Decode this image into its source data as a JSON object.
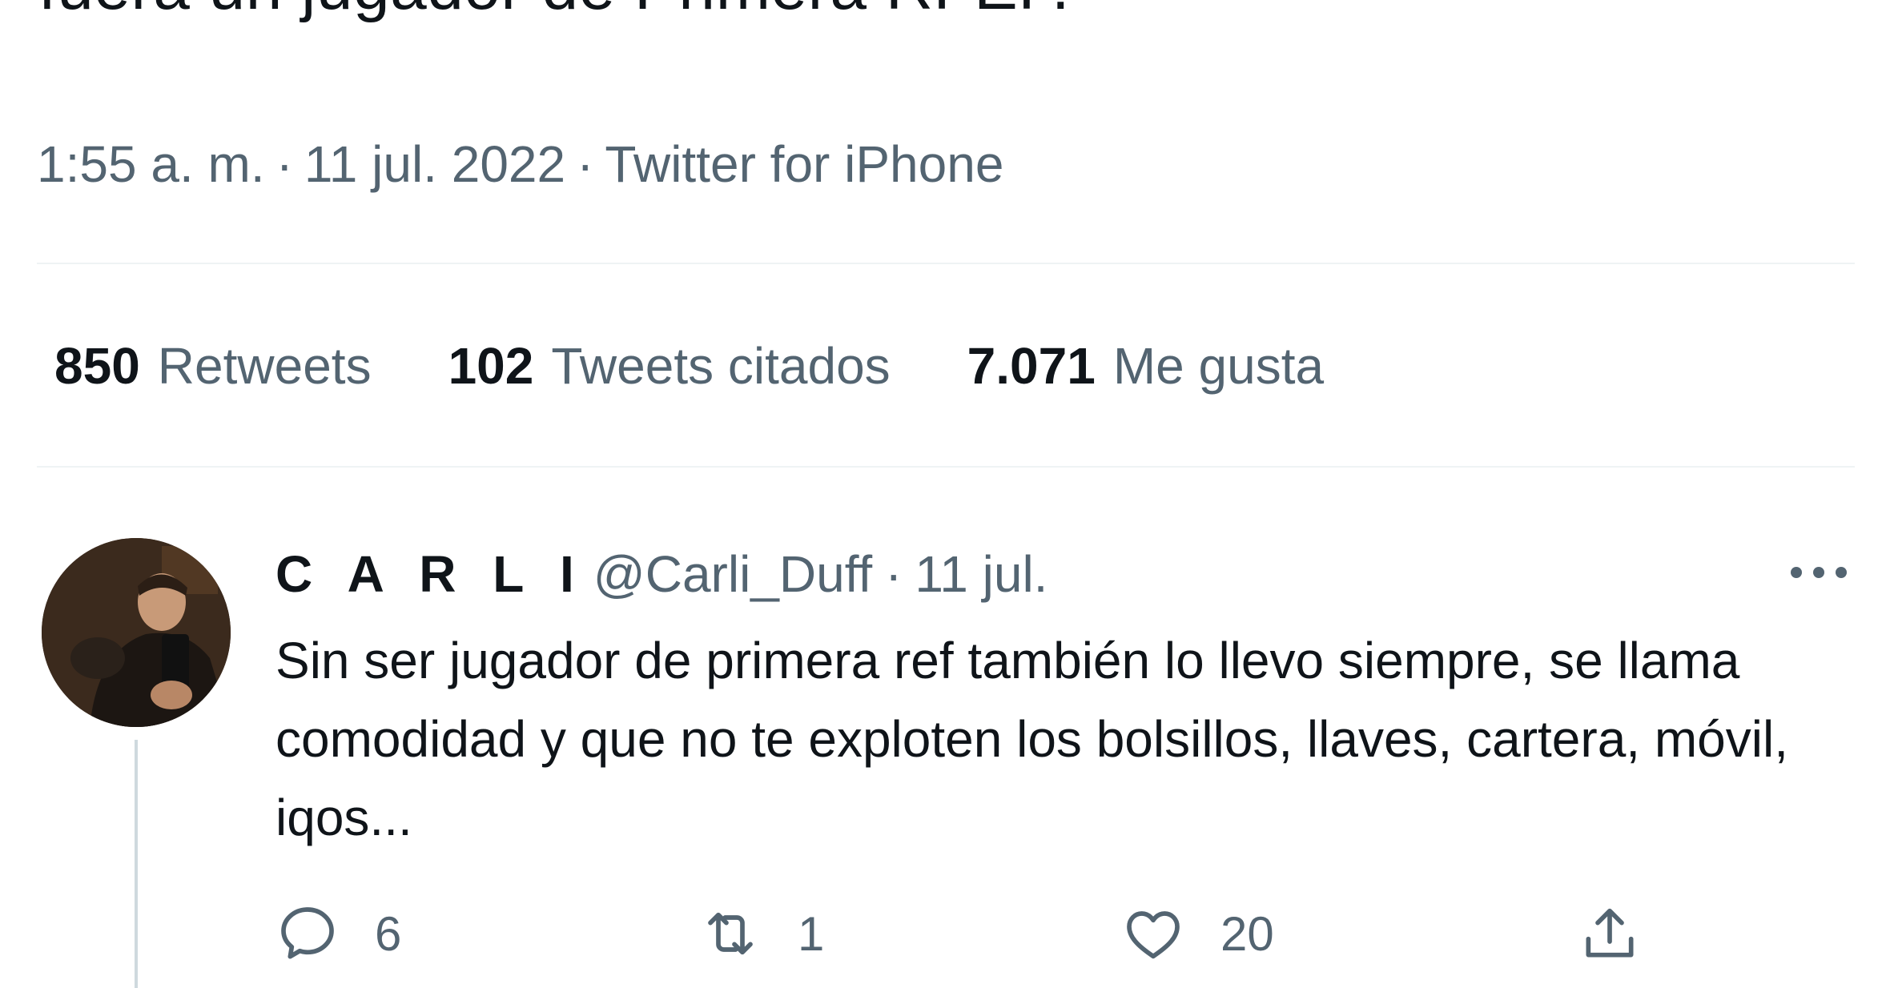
{
  "tweet": {
    "text_fragment": "fuera un jugador de Primera RFEF.",
    "time": "1:55 a. m.",
    "date": "11 jul. 2022",
    "source": "Twitter for iPhone",
    "separator": "·"
  },
  "stats": [
    {
      "count": "850",
      "label": "Retweets"
    },
    {
      "count": "102",
      "label": "Tweets citados"
    },
    {
      "count": "7.071",
      "label": "Me gusta"
    }
  ],
  "reply": {
    "name": "C A R L I",
    "handle": "@Carli_Duff",
    "separator": "·",
    "time": "11 jul.",
    "text": "Sin ser jugador de primera ref también lo llevo siempre, se llama comodidad y que no te exploten los bolsillos, llaves, cartera, móvil, iqos...",
    "actions": {
      "reply_count": "6",
      "retweet_count": "1",
      "like_count": "20"
    }
  },
  "icons": {
    "reply": "reply-icon",
    "retweet": "retweet-icon",
    "like": "heart-icon",
    "share": "share-icon",
    "more": "more-options-icon"
  },
  "colors": {
    "text": "#0f1419",
    "secondary": "#536471",
    "divider": "#eff3f4",
    "thread": "#cfd9de"
  }
}
